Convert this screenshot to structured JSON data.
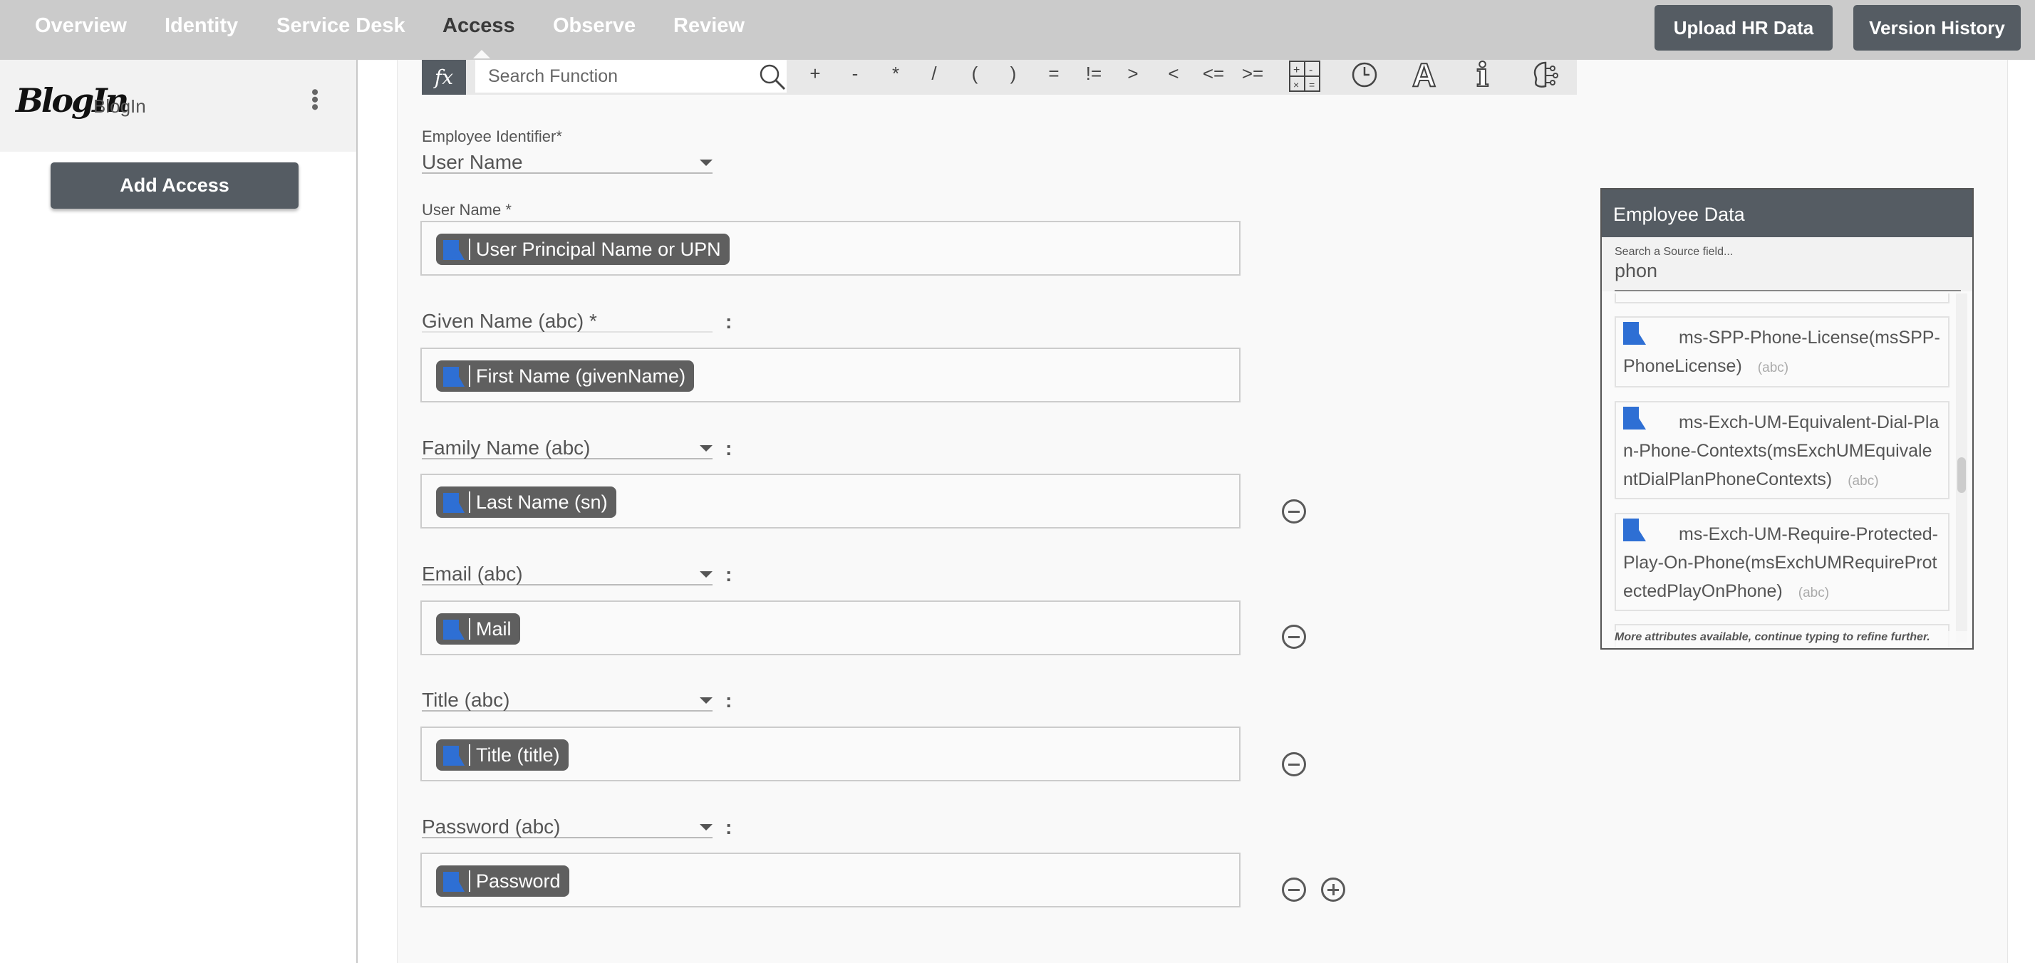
{
  "nav": {
    "tabs": [
      {
        "label": "Overview"
      },
      {
        "label": "Identity"
      },
      {
        "label": "Service Desk"
      },
      {
        "label": "Access",
        "active": true
      },
      {
        "label": "Observe"
      },
      {
        "label": "Review"
      }
    ],
    "upload_label": "Upload HR Data",
    "version_label": "Version History"
  },
  "sidebar": {
    "app_name": "BlogIn",
    "logo_text": "BlogIn",
    "add_access_label": "Add Access"
  },
  "toolbar": {
    "fx_label": "fx",
    "search_placeholder": "Search Function",
    "operators": [
      "+",
      "-",
      "*",
      "/",
      "(",
      ")",
      "=",
      "!=",
      ">",
      "<",
      "<=",
      ">="
    ],
    "icons": [
      "calculator-icon",
      "clock-icon",
      "text-icon",
      "info-icon",
      "brain-icon"
    ]
  },
  "form": {
    "identifier_label": "Employee Identifier*",
    "identifier_value": "User Name",
    "username_label": "User Name *",
    "username_chip": "User Principal Name or UPN",
    "rows": [
      {
        "attr": "Given Name (abc) *",
        "chip": "First Name (givenName)"
      },
      {
        "attr": "Family Name (abc)",
        "chip": "Last Name (sn)"
      },
      {
        "attr": "Email (abc)",
        "chip": "Mail"
      },
      {
        "attr": "Title (abc)",
        "chip": "Title (title)"
      },
      {
        "attr": "Password (abc)",
        "chip": "Password"
      }
    ],
    "colon": ":"
  },
  "employee_data": {
    "title": "Employee Data",
    "search_label": "Search a Source field...",
    "search_value": "phon",
    "items": [
      {
        "name": "ms-SPP-Phone-License(msSPP-PhoneLicense)",
        "type": "(abc)"
      },
      {
        "name": "ms-Exch-UM-Equivalent-Dial-Plan-Phone-Contexts(msExchUMEquivalentDialPlanPhoneContexts)",
        "type": "(abc)"
      },
      {
        "name": "ms-Exch-UM-Require-Protected-Play-On-Phone(msExchUMRequireProtectedPlayOnPhone)",
        "type": "(abc)"
      }
    ],
    "footer": "More attributes available, continue typing to refine further."
  },
  "colors": {
    "topbar": "#cbcbcb",
    "button": "#555c63",
    "chip": "#5f5f5f",
    "doc_icon": "#2e6fd4"
  }
}
